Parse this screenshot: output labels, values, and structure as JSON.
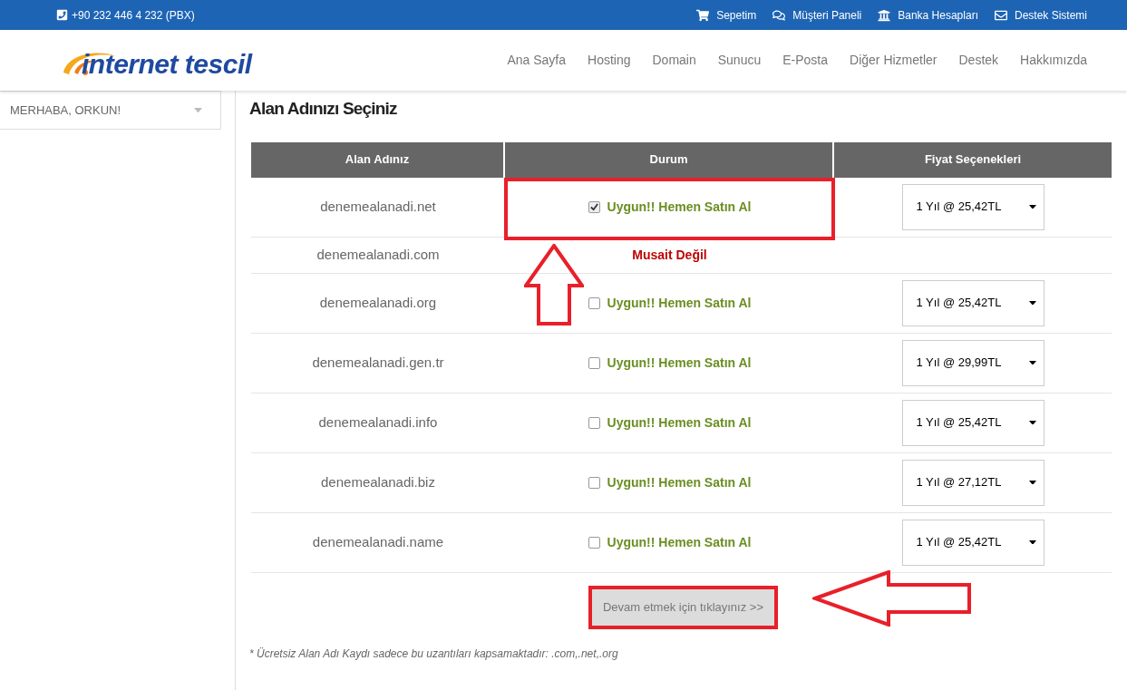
{
  "topbar": {
    "phone": "+90 232 446 4 232 (PBX)",
    "links": [
      {
        "label": "Sepetim"
      },
      {
        "label": "Müşteri Paneli"
      },
      {
        "label": "Banka Hesapları"
      },
      {
        "label": "Destek Sistemi"
      }
    ]
  },
  "logo": {
    "text": "internet tescil"
  },
  "nav": [
    "Ana Sayfa",
    "Hosting",
    "Domain",
    "Sunucu",
    "E-Posta",
    "Diğer Hizmetler",
    "Destek",
    "Hakkımızda"
  ],
  "sidebar": {
    "greeting": "MERHABA, ORKUN!"
  },
  "title": "Alan Adınızı Seçiniz",
  "table": {
    "columns": [
      "Alan Adınız",
      "Durum",
      "Fiyat Seçenekleri"
    ],
    "rows": [
      {
        "domain": "denemealanadi.net",
        "kind": "available",
        "status": "Uygun!! Hemen Satın Al",
        "checked": true,
        "price": "1 Yıl @ 25,42TL",
        "highlighted": true
      },
      {
        "domain": "denemealanadi.com",
        "kind": "unavailable",
        "status": "Musait Değil"
      },
      {
        "domain": "denemealanadi.org",
        "kind": "available",
        "status": "Uygun!! Hemen Satın Al",
        "checked": false,
        "price": "1 Yıl @ 25,42TL",
        "highlighted": false
      },
      {
        "domain": "denemealanadi.gen.tr",
        "kind": "available",
        "status": "Uygun!! Hemen Satın Al",
        "checked": false,
        "price": "1 Yıl @ 29,99TL",
        "highlighted": false
      },
      {
        "domain": "denemealanadi.info",
        "kind": "available",
        "status": "Uygun!! Hemen Satın Al",
        "checked": false,
        "price": "1 Yıl @ 25,42TL",
        "highlighted": false
      },
      {
        "domain": "denemealanadi.biz",
        "kind": "available",
        "status": "Uygun!! Hemen Satın Al",
        "checked": false,
        "price": "1 Yıl @ 27,12TL",
        "highlighted": false
      },
      {
        "domain": "denemealanadi.name",
        "kind": "available",
        "status": "Uygun!! Hemen Satın Al",
        "checked": false,
        "price": "1 Yıl @ 25,42TL",
        "highlighted": false
      }
    ]
  },
  "continue_button": "Devam etmek için tıklayınız >>",
  "footnote": "* Ücretsiz Alan Adı Kaydı sadece bu uzantıları kapsamaktadır: .com,.net,.org"
}
